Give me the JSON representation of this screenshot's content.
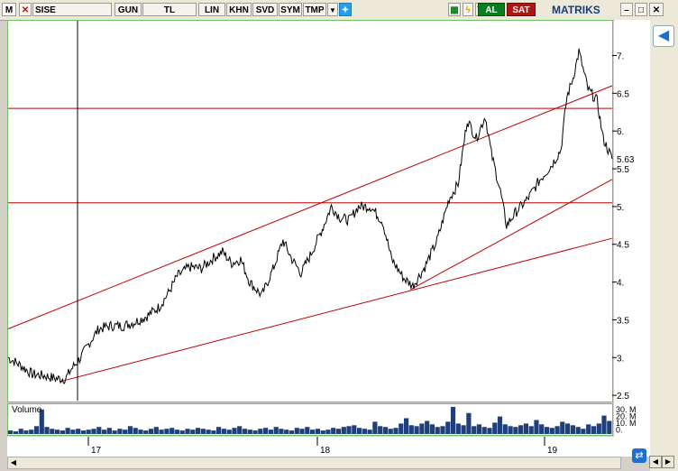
{
  "toolbar": {
    "m_label": "M",
    "symbol": "SISE",
    "buttons": [
      "GUN",
      "TL",
      "LIN",
      "KHN",
      "SVD",
      "SYM",
      "TMP"
    ],
    "buy_label": "AL",
    "sell_label": "SAT",
    "brand": "MATRIKS"
  },
  "volume_panel": {
    "label": "Volume"
  },
  "chart_data": {
    "type": "line",
    "symbol": "SISE",
    "y_ticks": [
      "2.5",
      "3.",
      "3.5",
      "4.",
      "4.5",
      "5.",
      "5.5",
      "6.",
      "6.5",
      "7."
    ],
    "ylim": [
      2.43,
      7.46
    ],
    "last_price": "5.63",
    "x_ticks": [
      "17",
      "18",
      "19"
    ],
    "volume_ticks": [
      "30. M",
      "20. M",
      "10. M",
      "0."
    ],
    "horizontal_lines": [
      6.3,
      5.05
    ],
    "trend_lines": [
      {
        "from": [
          0,
          3.38
        ],
        "to": [
          100,
          6.6
        ]
      },
      {
        "from": [
          8.5,
          2.68
        ],
        "to": [
          100,
          4.58
        ]
      },
      {
        "from": [
          66.6,
          3.9
        ],
        "to": [
          100,
          5.36
        ]
      }
    ],
    "price_series": [
      [
        0,
        3.0
      ],
      [
        2,
        2.9
      ],
      [
        4,
        2.78
      ],
      [
        6,
        2.76
      ],
      [
        8,
        2.72
      ],
      [
        9.5,
        2.72
      ],
      [
        10.5,
        2.85
      ],
      [
        12,
        3.0
      ],
      [
        13.5,
        3.2
      ],
      [
        15,
        3.38
      ],
      [
        17,
        3.42
      ],
      [
        19,
        3.42
      ],
      [
        21,
        3.47
      ],
      [
        23,
        3.55
      ],
      [
        25,
        3.67
      ],
      [
        26.5,
        3.85
      ],
      [
        28,
        4.08
      ],
      [
        30,
        4.2
      ],
      [
        32,
        4.18
      ],
      [
        34,
        4.32
      ],
      [
        35.5,
        4.4
      ],
      [
        37,
        4.25
      ],
      [
        38.5,
        4.3
      ],
      [
        40,
        4.0
      ],
      [
        42,
        3.82
      ],
      [
        44,
        4.2
      ],
      [
        45.5,
        4.55
      ],
      [
        47,
        4.3
      ],
      [
        48.5,
        4.12
      ],
      [
        50,
        4.35
      ],
      [
        52,
        4.7
      ],
      [
        53.5,
        5.0
      ],
      [
        55,
        4.85
      ],
      [
        56.5,
        4.82
      ],
      [
        58,
        5.0
      ],
      [
        60,
        5.0
      ],
      [
        62,
        4.8
      ],
      [
        63.5,
        4.3
      ],
      [
        65.5,
        4.05
      ],
      [
        67,
        3.95
      ],
      [
        69,
        4.2
      ],
      [
        71,
        4.55
      ],
      [
        73,
        5.1
      ],
      [
        74.5,
        5.3
      ],
      [
        76,
        6.15
      ],
      [
        77.5,
        5.9
      ],
      [
        79,
        6.2
      ],
      [
        80,
        5.7
      ],
      [
        81.5,
        5.2
      ],
      [
        82.5,
        4.75
      ],
      [
        84,
        4.92
      ],
      [
        86,
        5.1
      ],
      [
        88,
        5.35
      ],
      [
        90,
        5.55
      ],
      [
        91.5,
        5.75
      ],
      [
        92.5,
        6.45
      ],
      [
        93.5,
        6.7
      ],
      [
        94.5,
        7.05
      ],
      [
        96,
        6.55
      ],
      [
        97.5,
        6.4
      ],
      [
        98.5,
        5.9
      ],
      [
        100,
        5.63
      ]
    ],
    "volume_values": [
      4,
      3,
      6,
      4,
      5,
      9,
      28,
      8,
      6,
      5,
      4,
      7,
      5,
      6,
      4,
      5,
      6,
      8,
      5,
      7,
      4,
      6,
      5,
      9,
      7,
      5,
      4,
      6,
      8,
      5,
      6,
      7,
      5,
      4,
      6,
      5,
      7,
      6,
      5,
      4,
      8,
      6,
      5,
      7,
      9,
      6,
      5,
      4,
      6,
      7,
      5,
      8,
      6,
      5,
      4,
      7,
      6,
      8,
      5,
      6,
      4,
      5,
      7,
      6,
      8,
      9,
      10,
      7,
      6,
      5,
      14,
      9,
      8,
      6,
      7,
      12,
      18,
      10,
      9,
      12,
      15,
      11,
      8,
      9,
      14,
      31,
      12,
      10,
      24,
      9,
      11,
      8,
      7,
      13,
      20,
      11,
      9,
      8,
      10,
      12,
      9,
      16,
      11,
      8,
      7,
      9,
      14,
      12,
      10,
      8,
      6,
      11,
      9,
      12,
      21,
      15
    ]
  }
}
